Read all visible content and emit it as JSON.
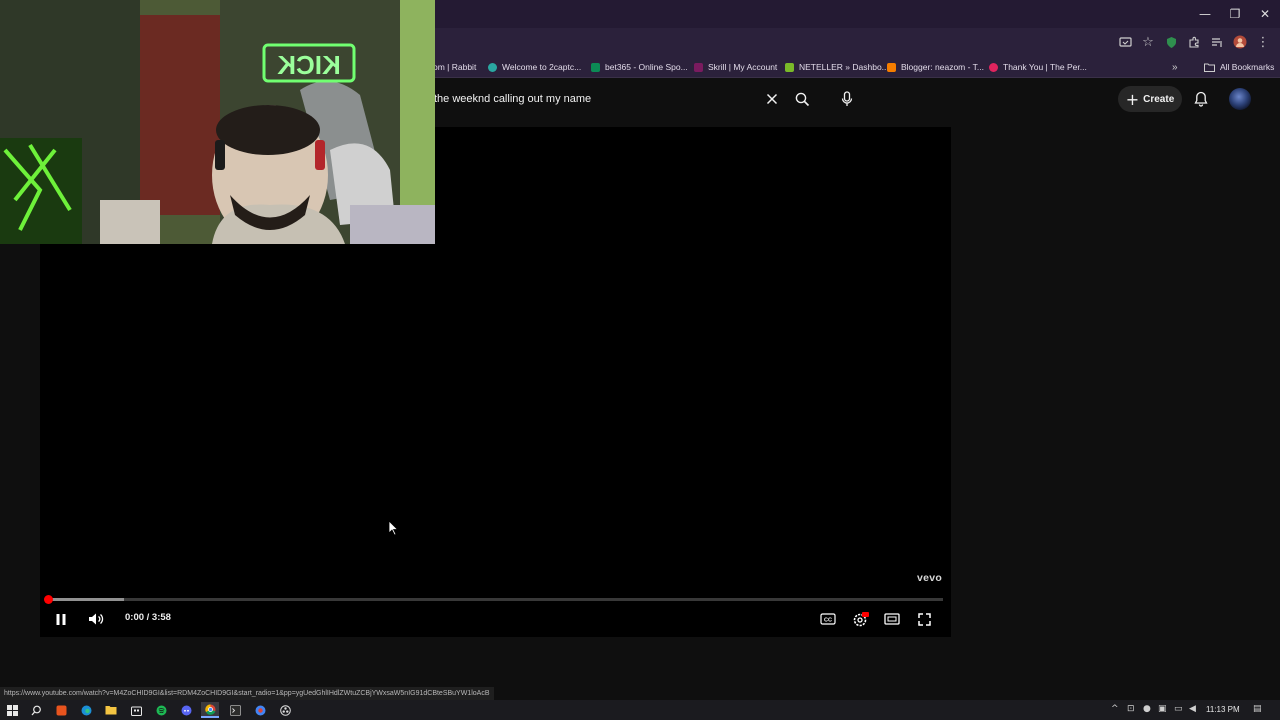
{
  "window": {
    "minimize": "—",
    "restore": "❐",
    "close": "✕"
  },
  "bookmarks": [
    {
      "label": "om | Rabbit",
      "color": "#666"
    },
    {
      "label": "Welcome to 2captc...",
      "color": "#2aa7a1"
    },
    {
      "label": "bet365 - Online Spo...",
      "color": "#0c8a55"
    },
    {
      "label": "Skrill | My Account",
      "color": "#7a1b5f"
    },
    {
      "label": "NETELLER » Dashbo...",
      "color": "#7ab929"
    },
    {
      "label": "Blogger: neazom - T...",
      "color": "#f57d00"
    },
    {
      "label": "Thank You | The Per...",
      "color": "#e0245e"
    },
    {
      "label": "All Bookmarks",
      "color": "#cccccc"
    }
  ],
  "search": {
    "value": "the weeknd calling out my name"
  },
  "header": {
    "create_label": "Create"
  },
  "player": {
    "watermark": "vevo",
    "current_time": "0:00",
    "duration": "3:58",
    "time_display": "0:00 / 3:58",
    "progress_fraction": 0.0,
    "buffered_fraction": 0.085,
    "progress_color": "#ff0000"
  },
  "status_url": "https://www.youtube.com/watch?v=M4ZoCHID9GI&list=RDM4ZoCHID9GI&start_radio=1&pp=ygUedGhlIHdlZWtuZCBjYWxsaW5nIG91dCBteSBuYW1loAcB",
  "webcam": {
    "sign_text": "KICK"
  },
  "taskbar": {
    "clock": "11:13 PM"
  }
}
